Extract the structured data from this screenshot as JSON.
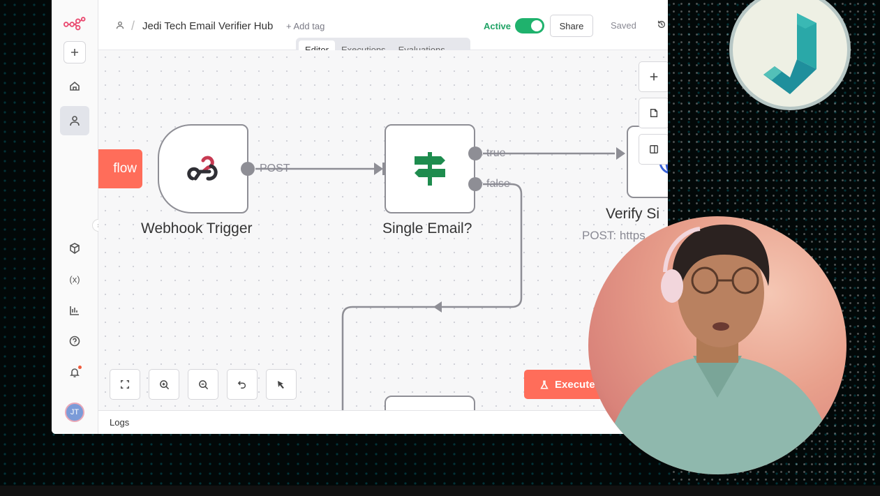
{
  "sidebar": {
    "logo_icon": "n8n-logo-icon",
    "avatar_initials": "JT"
  },
  "header": {
    "workflow_name": "Jedi Tech Email Verifier Hub",
    "add_tag": "+ Add tag",
    "active_label": "Active",
    "active": true,
    "share_label": "Share",
    "saved_label": "Saved"
  },
  "tabs": [
    {
      "label": "Editor",
      "selected": true
    },
    {
      "label": "Executions",
      "selected": false
    },
    {
      "label": "Evaluations",
      "selected": false
    }
  ],
  "canvas": {
    "partial_node_label": "flow",
    "nodes": [
      {
        "label": "Webhook Trigger",
        "icon": "webhook-icon"
      },
      {
        "label": "Single Email?",
        "icon": "signpost-icon"
      },
      {
        "label": "Verify Si",
        "subtitle": "POST: https",
        "icon": "globe-icon"
      }
    ],
    "edge_labels": {
      "post": "POST",
      "true": "true",
      "false": "false"
    },
    "execute_label": "Execute"
  },
  "logs_label": "Logs",
  "colors": {
    "accent": "#ff6d5a",
    "active_green": "#1fb26d",
    "brand_pink": "#ea4b71",
    "if_node_green": "#1e8c4e",
    "http_node_blue": "#3a63d9"
  }
}
